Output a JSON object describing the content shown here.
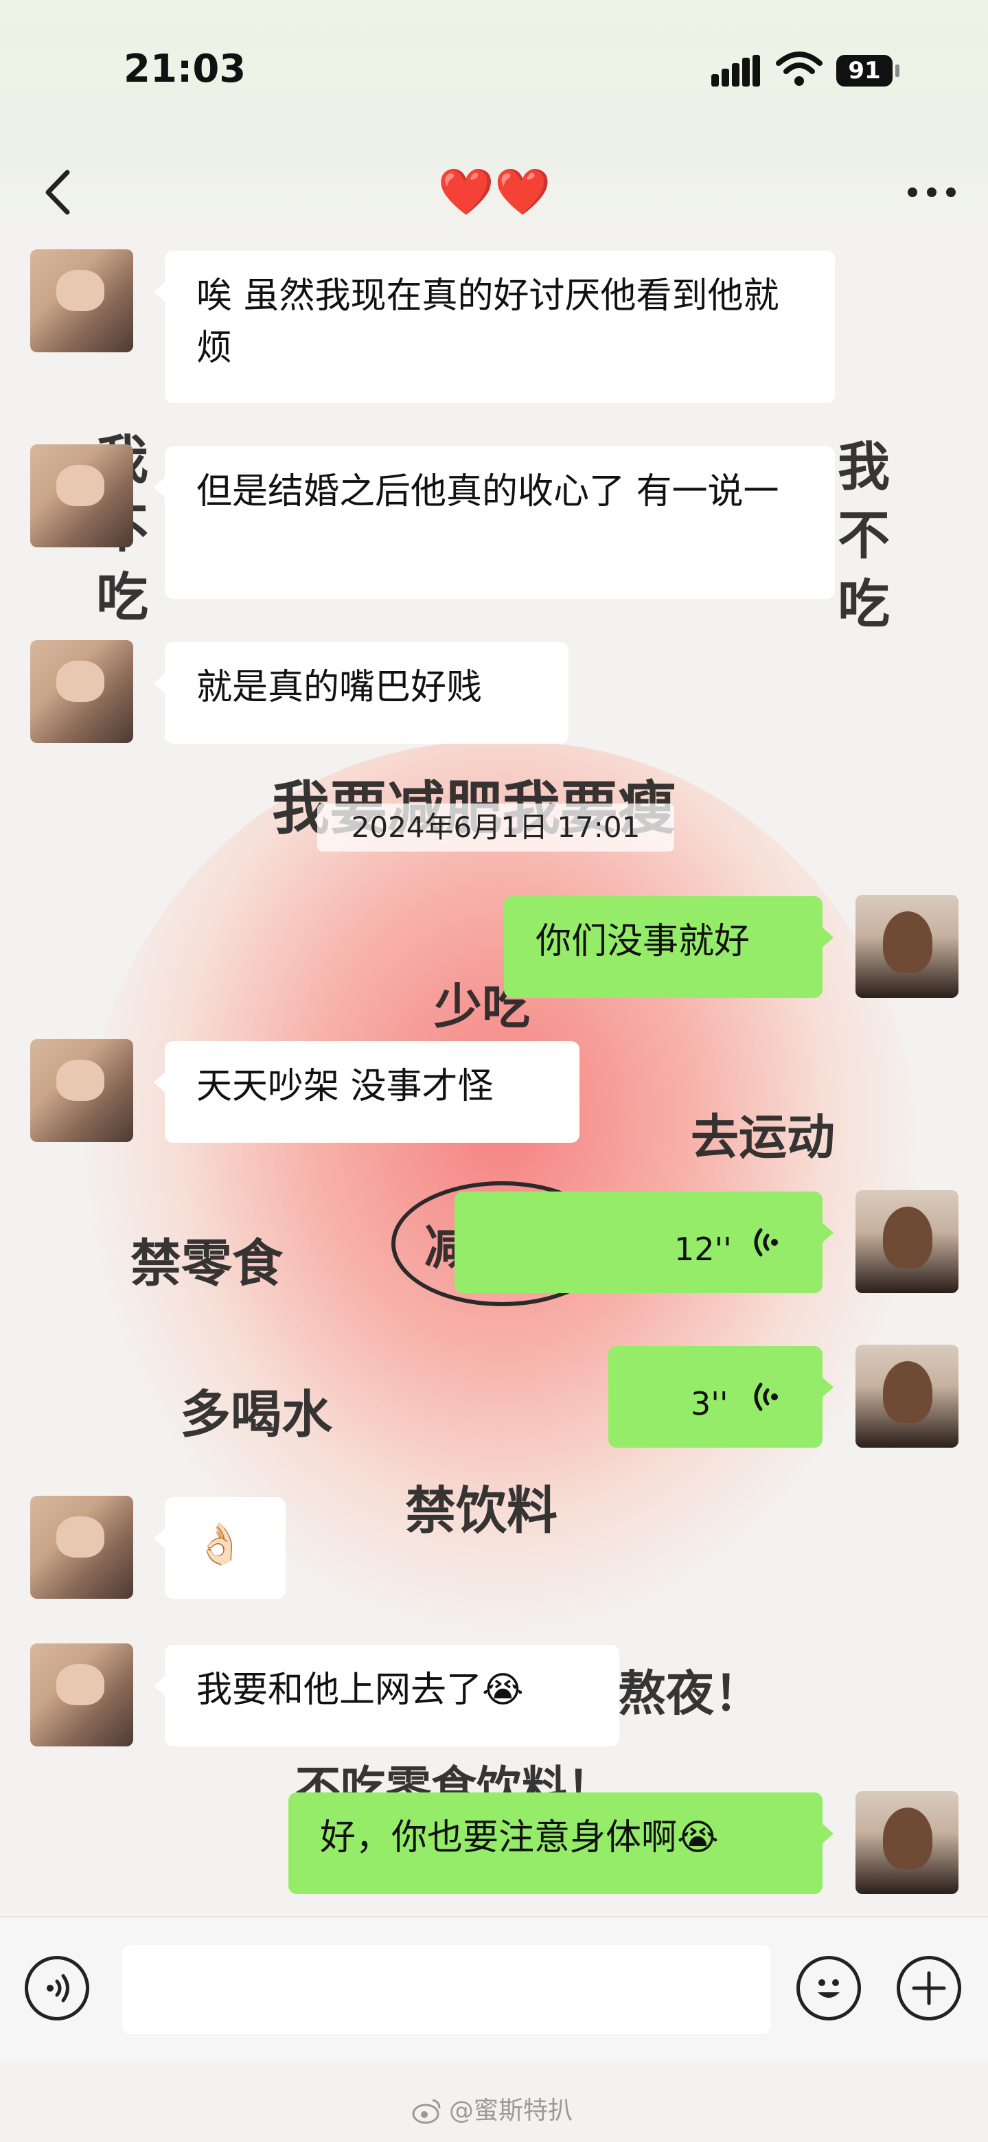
{
  "status_bar": {
    "time": "21:03",
    "battery_level": "91"
  },
  "nav": {
    "title": "❤️❤️"
  },
  "timestamp": "2024年6月1日 17:01",
  "messages": [
    {
      "side": "in",
      "type": "text",
      "text": "唉 虽然我现在真的好讨厌他看到他就烦"
    },
    {
      "side": "in",
      "type": "text",
      "text": "但是结婚之后他真的收心了 有一说一"
    },
    {
      "side": "in",
      "type": "text",
      "text": "就是真的嘴巴好贱"
    },
    {
      "side": "out",
      "type": "text",
      "text": "你们没事就好"
    },
    {
      "side": "in",
      "type": "text",
      "text": "天天吵架 没事才怪"
    },
    {
      "side": "out",
      "type": "voice",
      "duration": "12''"
    },
    {
      "side": "out",
      "type": "voice",
      "duration": "3''"
    },
    {
      "side": "in",
      "type": "emoji",
      "text": "👌🏻"
    },
    {
      "side": "in",
      "type": "text",
      "text": "我要和他上网去了😭"
    },
    {
      "side": "out",
      "type": "text",
      "text": "好，你也要注意身体啊😭"
    }
  ],
  "background_doodles": {
    "left_column": "我不吃",
    "right_column": "我不吃",
    "headline": "我要减肥我要瘦",
    "eat_less": "少吃",
    "exercise": "去运动",
    "no_snacks": "禁零食",
    "drink_water": "多喝水",
    "no_drinks": "禁饮料",
    "sun_text": "减",
    "partial_1": "熬夜！",
    "partial_2": "不吃零食饮料！"
  },
  "colors": {
    "bubble_out": "#95ec69",
    "bubble_in": "#ffffff",
    "heart_glow": "#f66e6e"
  },
  "icons": {
    "back": "chevron-left-icon",
    "more": "more-dots-icon",
    "signal": "cellular-signal-icon",
    "wifi": "wifi-icon",
    "battery": "battery-icon",
    "voice_toggle": "voice-input-icon",
    "emoji": "emoji-icon",
    "plus": "plus-icon",
    "voice_wave": "voice-wave-icon",
    "weibo": "weibo-logo-icon"
  },
  "watermark": "@蜜斯特扒"
}
